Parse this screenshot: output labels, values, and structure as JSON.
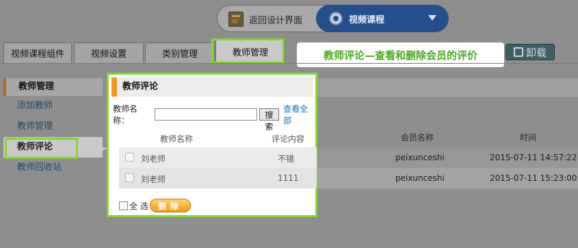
{
  "topbar": {
    "back_label": "返回设计界面",
    "module_label": "视频课程"
  },
  "tabs": [
    {
      "label": "视频课程组件"
    },
    {
      "label": "视频设置"
    },
    {
      "label": "类别管理"
    },
    {
      "label": "教师管理"
    }
  ],
  "uninstall_label": "卸载",
  "callout": "教师评论—查看和删除会员的评价",
  "sidebar": {
    "header": "教师管理",
    "items": [
      {
        "label": "添加教师"
      },
      {
        "label": "教师管理"
      },
      {
        "label": "教师评论"
      },
      {
        "label": "教师回收站"
      }
    ]
  },
  "background_table": {
    "columns": [
      "会员名称",
      "时间"
    ],
    "rows": [
      {
        "member": "peixunceshi",
        "time": "2015-07-11 14:57:22"
      },
      {
        "member": "peixunceshi",
        "time": "2015-07-11 15:23:00"
      }
    ]
  },
  "popup": {
    "title": "教师评论",
    "search_label": "教师名称：",
    "search_value": "",
    "search_button": "搜索",
    "view_all": "查看全部",
    "columns": [
      "教师名称",
      "评论内容"
    ],
    "rows": [
      {
        "teacher": "刘老师",
        "comment": "不错"
      },
      {
        "teacher": "刘老师",
        "comment": "1111"
      }
    ],
    "select_all": "全 选",
    "delete_button": "删除"
  },
  "colors": {
    "highlight": "#84d82e",
    "callout_text": "#4caa1e",
    "module_pill": "#23508a",
    "accent_orange": "#f29a20"
  }
}
